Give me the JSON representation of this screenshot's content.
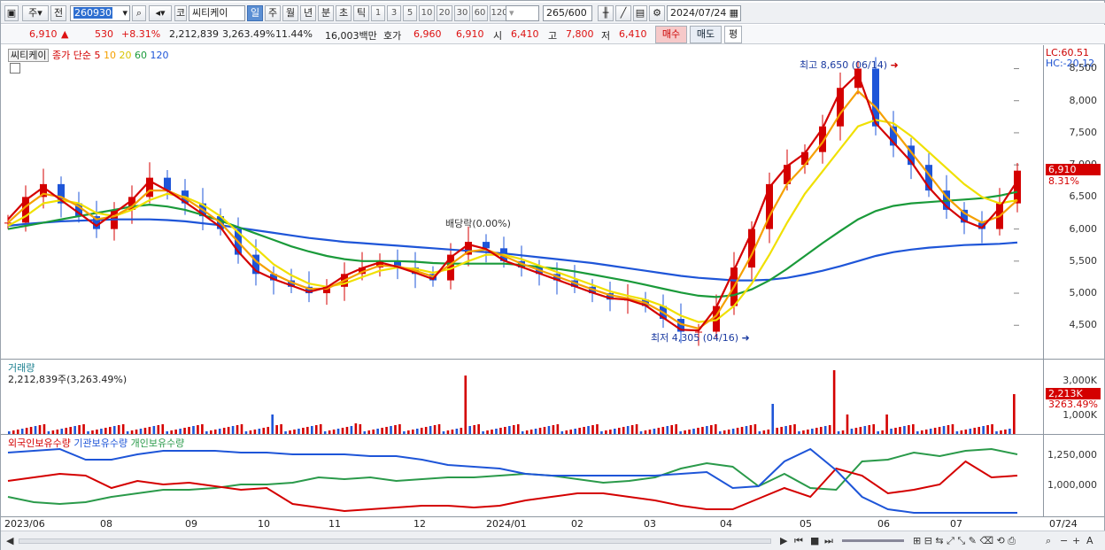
{
  "toolbar": {
    "market": "주",
    "mode": "전",
    "code": "260930",
    "name_prefix": "코",
    "name": "씨티케이",
    "periods": [
      "일",
      "주",
      "월",
      "년",
      "분",
      "초",
      "틱"
    ],
    "active_period": "일",
    "intervals": [
      "1",
      "3",
      "5",
      "10",
      "20",
      "30",
      "60",
      "120"
    ],
    "count": "265",
    "count_max": "/600",
    "date": "2024/07/24"
  },
  "quote": {
    "price": "6,910",
    "change_arrow": "▲",
    "change": "530",
    "change_pct": "+8.31%",
    "volume": "2,212,839",
    "volume_pct": "3,263.49%",
    "turnover": "11.44%",
    "amount": "16,003백만",
    "ask_label": "호가",
    "ask": "6,960",
    "bid": "6,910",
    "open_label": "시",
    "open": "6,410",
    "high_label": "고",
    "high": "7,800",
    "low_label": "저",
    "low": "6,410",
    "buy": "매수",
    "sell": "매도",
    "eval": "평"
  },
  "price_pane": {
    "stock": "씨티케이",
    "legend_title": "종가 단순",
    "ma_labels": [
      "5",
      "10",
      "20",
      "60",
      "120"
    ],
    "ma_colors": [
      "#d40000",
      "#f5a000",
      "#f0e000",
      "#1a9a3a",
      "#1e55d8"
    ],
    "high_annot": "최고 8,650 (06/14)",
    "low_annot": "최저 4,305 (04/16)",
    "dividend_annot": "배당락(0.00%)",
    "lc": "LC:60.51",
    "hc": "HC:-20.12",
    "y_ticks": [
      "8,500",
      "8,000",
      "7,500",
      "7,000",
      "6,500",
      "6,000",
      "5,500",
      "5,000",
      "4,500"
    ],
    "last_price": "6,910",
    "last_pct": "8.31%"
  },
  "volume_pane": {
    "title": "거래량",
    "info": "2,212,839주(3,263.49%)",
    "y_ticks": [
      "3,000K",
      "2,000K",
      "1,000K"
    ],
    "last_vol": "2,213K",
    "last_pct": "3263.49%"
  },
  "holding_pane": {
    "legend": [
      "외국인보유수량",
      "기관보유수량",
      "개인보유수량"
    ],
    "colors": [
      "#d40000",
      "#1e55d8",
      "#2a9a4a"
    ],
    "y_ticks": [
      "1,250,000",
      "1,000,000"
    ]
  },
  "x_axis": [
    "2023/06",
    "08",
    "09",
    "10",
    "11",
    "12",
    "2024/01",
    "02",
    "03",
    "04",
    "05",
    "06",
    "07",
    "07/24"
  ],
  "chart_data": {
    "type": "line",
    "title": "씨티케이",
    "candles_close": [
      6100,
      6500,
      6700,
      6400,
      6200,
      6000,
      6300,
      6500,
      6800,
      6600,
      6400,
      6200,
      6000,
      5600,
      5300,
      5200,
      5100,
      5000,
      5100,
      5300,
      5400,
      5500,
      5400,
      5300,
      5200,
      5600,
      5800,
      5700,
      5500,
      5400,
      5300,
      5200,
      5100,
      5000,
      4900,
      4900,
      4800,
      4600,
      4400,
      4400,
      4800,
      5400,
      6000,
      6700,
      7000,
      7200,
      7600,
      8200,
      8500,
      7600,
      7300,
      7000,
      6600,
      6300,
      6100,
      6000,
      6400,
      6910
    ],
    "ylim": [
      4200,
      8700
    ],
    "y_ticks": [
      8500,
      8000,
      7500,
      7000,
      6500,
      6000,
      5500,
      5000,
      4500
    ],
    "series": [
      {
        "name": "5",
        "values": [
          6150,
          6450,
          6650,
          6450,
          6250,
          6050,
          6250,
          6450,
          6750,
          6600,
          6420,
          6230,
          6030,
          5650,
          5350,
          5220,
          5120,
          5020,
          5090,
          5270,
          5390,
          5480,
          5410,
          5320,
          5220,
          5560,
          5760,
          5690,
          5510,
          5410,
          5310,
          5210,
          5110,
          5010,
          4920,
          4900,
          4810,
          4620,
          4430,
          4420,
          4780,
          5360,
          5950,
          6650,
          6980,
          7180,
          7570,
          8150,
          8420,
          7650,
          7350,
          7050,
          6650,
          6350,
          6130,
          6020,
          6330,
          6750
        ]
      },
      {
        "name": "10",
        "values": [
          6100,
          6350,
          6550,
          6500,
          6350,
          6150,
          6200,
          6350,
          6600,
          6600,
          6480,
          6300,
          6100,
          5800,
          5500,
          5300,
          5170,
          5070,
          5070,
          5200,
          5330,
          5430,
          5420,
          5350,
          5260,
          5450,
          5650,
          5680,
          5580,
          5460,
          5360,
          5260,
          5160,
          5060,
          4970,
          4920,
          4850,
          4700,
          4520,
          4450,
          4650,
          5100,
          5600,
          6200,
          6700,
          7000,
          7350,
          7800,
          8150,
          7900,
          7550,
          7200,
          6850,
          6500,
          6250,
          6100,
          6200,
          6450
        ]
      },
      {
        "name": "20",
        "values": [
          6050,
          6200,
          6400,
          6450,
          6400,
          6250,
          6200,
          6300,
          6450,
          6550,
          6500,
          6380,
          6200,
          5950,
          5700,
          5450,
          5280,
          5150,
          5100,
          5150,
          5250,
          5350,
          5400,
          5380,
          5320,
          5380,
          5500,
          5600,
          5600,
          5530,
          5430,
          5330,
          5230,
          5130,
          5030,
          4960,
          4900,
          4800,
          4650,
          4550,
          4580,
          4800,
          5150,
          5600,
          6100,
          6550,
          6900,
          7250,
          7600,
          7700,
          7650,
          7450,
          7200,
          6950,
          6700,
          6500,
          6400,
          6450
        ]
      },
      {
        "name": "60",
        "values": [
          6000,
          6050,
          6100,
          6150,
          6200,
          6250,
          6300,
          6350,
          6380,
          6350,
          6300,
          6220,
          6130,
          6030,
          5930,
          5830,
          5730,
          5650,
          5580,
          5530,
          5500,
          5500,
          5500,
          5490,
          5470,
          5460,
          5460,
          5460,
          5460,
          5440,
          5410,
          5380,
          5340,
          5290,
          5240,
          5190,
          5130,
          5070,
          5010,
          4960,
          4940,
          4970,
          5060,
          5200,
          5380,
          5580,
          5780,
          5970,
          6150,
          6280,
          6360,
          6400,
          6420,
          6440,
          6460,
          6480,
          6520,
          6580
        ]
      },
      {
        "name": "120",
        "values": [
          6050,
          6080,
          6100,
          6120,
          6130,
          6140,
          6150,
          6150,
          6150,
          6140,
          6120,
          6090,
          6060,
          6020,
          5980,
          5940,
          5900,
          5860,
          5830,
          5800,
          5780,
          5760,
          5740,
          5720,
          5700,
          5680,
          5660,
          5640,
          5620,
          5590,
          5560,
          5530,
          5500,
          5470,
          5430,
          5390,
          5350,
          5310,
          5270,
          5240,
          5220,
          5200,
          5200,
          5210,
          5240,
          5290,
          5350,
          5420,
          5500,
          5580,
          5640,
          5680,
          5710,
          5730,
          5750,
          5760,
          5770,
          5790
        ]
      }
    ]
  }
}
